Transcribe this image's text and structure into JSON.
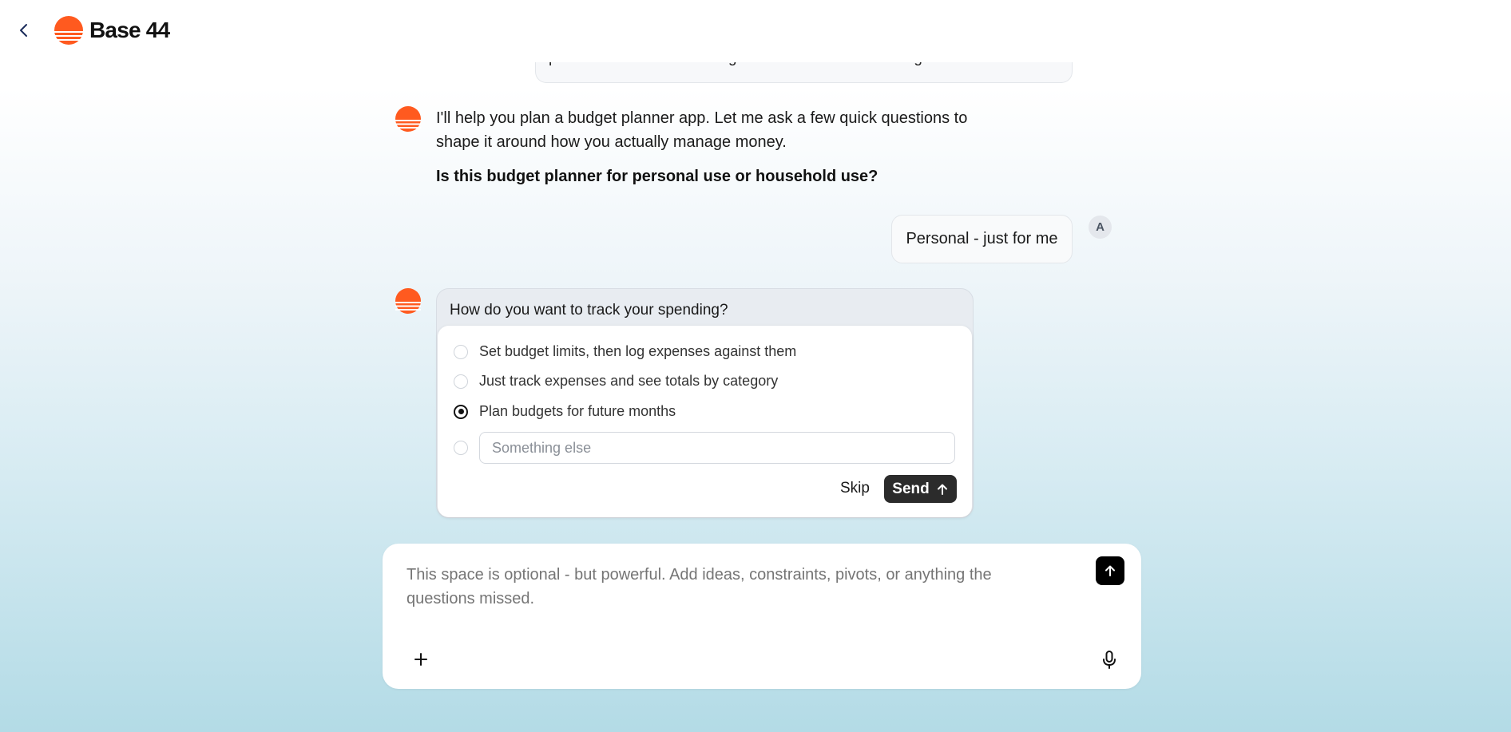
{
  "header": {
    "brand_name": "Base 44",
    "back_icon": "chevron-left-icon",
    "logo_icon": "sunset-logo-icon",
    "logo_color": "#FF5A1F"
  },
  "conversation": {
    "previous_user_message_fragment": "personal or household budgets with customizable categories.",
    "bot_intro": "I'll help you plan a budget planner app. Let me ask a few quick questions to shape it around how you actually manage money.",
    "bot_question": "Is this budget planner for personal use or household use?",
    "user_reply": "Personal - just for me",
    "user_avatar_initial": "A"
  },
  "question_card": {
    "title": "How do you want to track your spending?",
    "options": [
      {
        "label": "Set budget limits, then log expenses against them",
        "selected": false
      },
      {
        "label": "Just track expenses and see totals by category",
        "selected": false
      },
      {
        "label": "Plan budgets for future months",
        "selected": true
      }
    ],
    "other_placeholder": "Something else",
    "skip_label": "Skip",
    "send_label": "Send",
    "send_icon": "arrow-up-icon"
  },
  "composer": {
    "placeholder": "This space is optional - but powerful. Add ideas, constraints, pivots, or anything the questions missed.",
    "send_icon": "arrow-up-icon",
    "attach_icon": "plus-icon",
    "mic_icon": "microphone-icon"
  }
}
